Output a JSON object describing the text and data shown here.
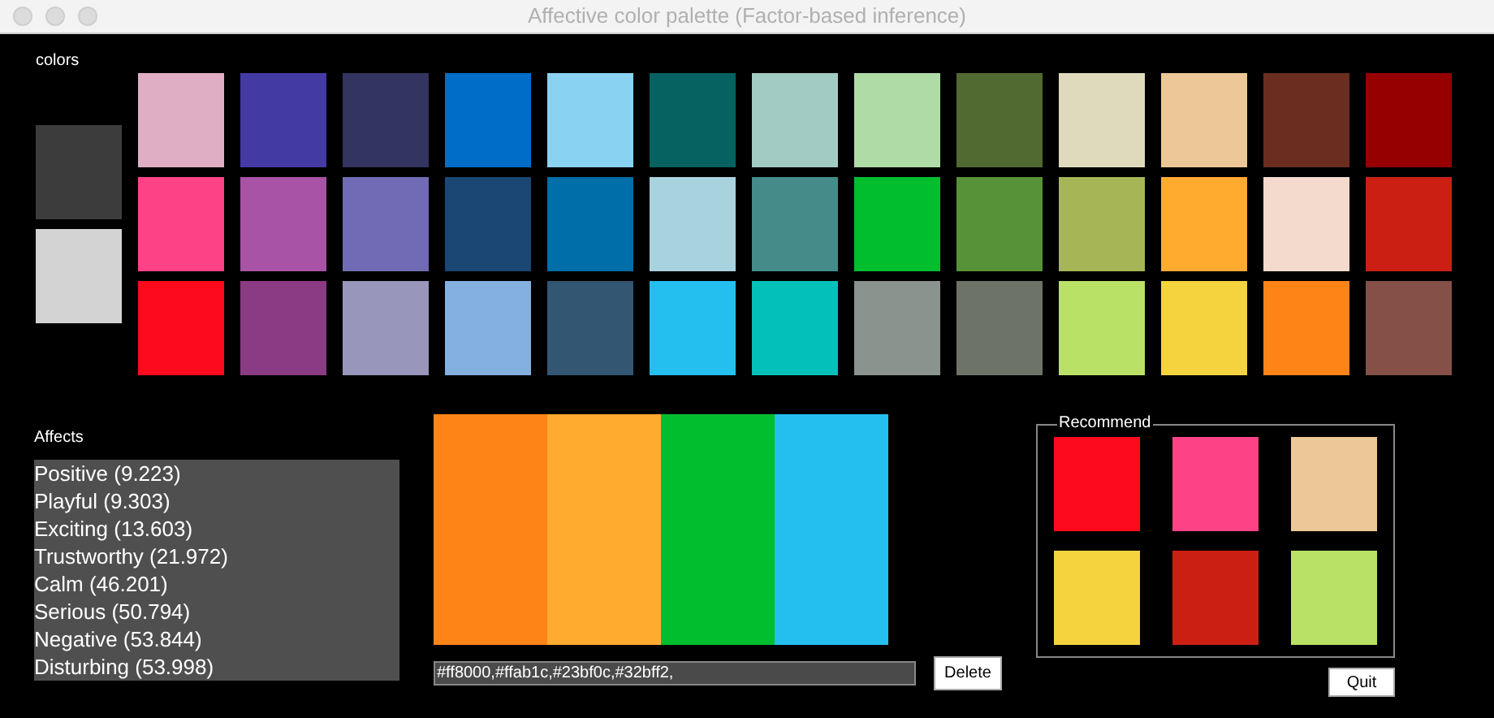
{
  "window": {
    "title": "Affective color palette (Factor-based inference)"
  },
  "colors": {
    "label": "colors",
    "side_swatches": [
      {
        "color": "#3c3c3c"
      },
      {
        "color": "#d3d3d3"
      }
    ],
    "rows": [
      {
        "swatches": [
          {
            "color": "#e0aec4"
          },
          {
            "color": "#443aa4"
          },
          {
            "color": "#33345f"
          },
          {
            "color": "#006ec9"
          },
          {
            "color": "#8ad2f1"
          },
          {
            "color": "#066260"
          },
          {
            "color": "#a2cbc3"
          },
          {
            "color": "#afdba6"
          },
          {
            "color": "#516a32"
          },
          {
            "color": "#dfdabc"
          },
          {
            "color": "#ecc797"
          },
          {
            "color": "#6a2e20"
          },
          {
            "color": "#960000"
          }
        ]
      },
      {
        "swatches": [
          {
            "color": "#fd4286"
          },
          {
            "color": "#a853a5"
          },
          {
            "color": "#706bb4"
          },
          {
            "color": "#1b4774"
          },
          {
            "color": "#006ea8"
          },
          {
            "color": "#a9d2df"
          },
          {
            "color": "#448b8a"
          },
          {
            "color": "#00be2e"
          },
          {
            "color": "#579238"
          },
          {
            "color": "#a6b656"
          },
          {
            "color": "#ffab30"
          },
          {
            "color": "#f4dacc"
          },
          {
            "color": "#cb1f14"
          }
        ]
      },
      {
        "swatches": [
          {
            "color": "#fd0a1d"
          },
          {
            "color": "#8a3b84"
          },
          {
            "color": "#9896bb"
          },
          {
            "color": "#84b0e0"
          },
          {
            "color": "#335672"
          },
          {
            "color": "#24bfef"
          },
          {
            "color": "#03c0bb"
          },
          {
            "color": "#8b938f"
          },
          {
            "color": "#6d7467"
          },
          {
            "color": "#b9e165"
          },
          {
            "color": "#f4d33f"
          },
          {
            "color": "#ff8418"
          },
          {
            "color": "#855047"
          }
        ]
      }
    ]
  },
  "affects": {
    "label": "Affects",
    "items": [
      "Positive (9.223)",
      "Playful (9.303)",
      "Exciting (13.603)",
      "Trustworthy (21.972)",
      "Calm (46.201)",
      "Serious (50.794)",
      "Negative (53.844)",
      "Disturbing (53.998)"
    ]
  },
  "palette": {
    "stripes": [
      {
        "color": "#ff8418"
      },
      {
        "color": "#ffab30"
      },
      {
        "color": "#00be2e"
      },
      {
        "color": "#24bfef"
      }
    ],
    "codes": "#ff8000,#ffab1c,#23bf0c,#32bff2,",
    "delete_button": "Delete"
  },
  "recommend": {
    "title": "Recommend",
    "swatches": [
      {
        "color": "#fd0a1d"
      },
      {
        "color": "#fd4286"
      },
      {
        "color": "#ecc797"
      },
      {
        "color": "#f4d33f"
      },
      {
        "color": "#cb1f14"
      },
      {
        "color": "#b9e165"
      }
    ]
  },
  "quit_button": "Quit"
}
